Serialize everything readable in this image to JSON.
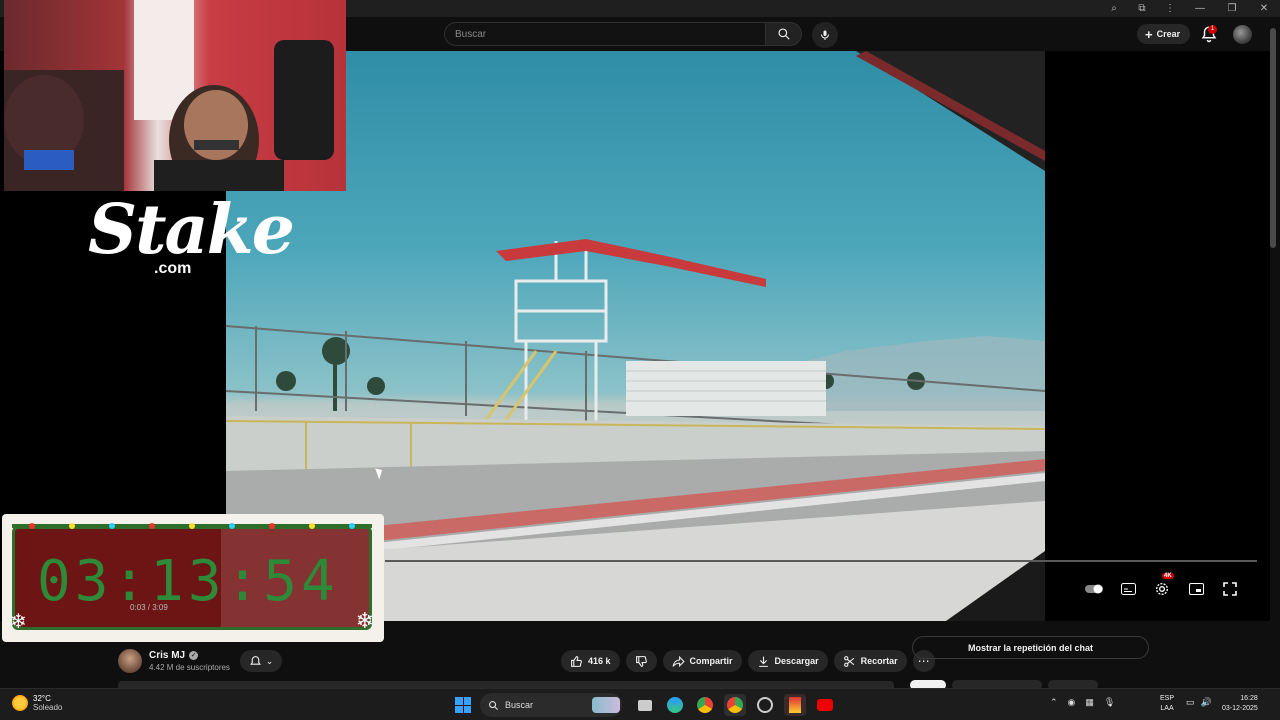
{
  "header": {
    "search_placeholder": "Buscar",
    "create_label": "Crear",
    "notification_count": "1"
  },
  "overlay": {
    "brand": "Stake",
    "brand_suffix": ".com",
    "timer": "03:13:54",
    "video_time": "0:03 / 3:09"
  },
  "player": {
    "quality_badge": "4K"
  },
  "channel": {
    "name": "Cris MJ",
    "subscribers": "4.42 M de suscriptores"
  },
  "actions": {
    "like_count": "416 k",
    "share_label": "Compartir",
    "download_label": "Descargar",
    "clip_label": "Recortar"
  },
  "chat": {
    "replay_label": "Mostrar la repetición del chat"
  },
  "taskbar": {
    "temperature": "32°C",
    "weather_condition": "Soleado",
    "search_label": "Buscar",
    "language": "ESP",
    "keyboard_layout": "LAA",
    "time": "16:28",
    "date": "03-12-2025"
  },
  "colors": {
    "background": "#0f0f0f",
    "accent_red": "#cc0000",
    "timer_green": "#2d8a39"
  }
}
